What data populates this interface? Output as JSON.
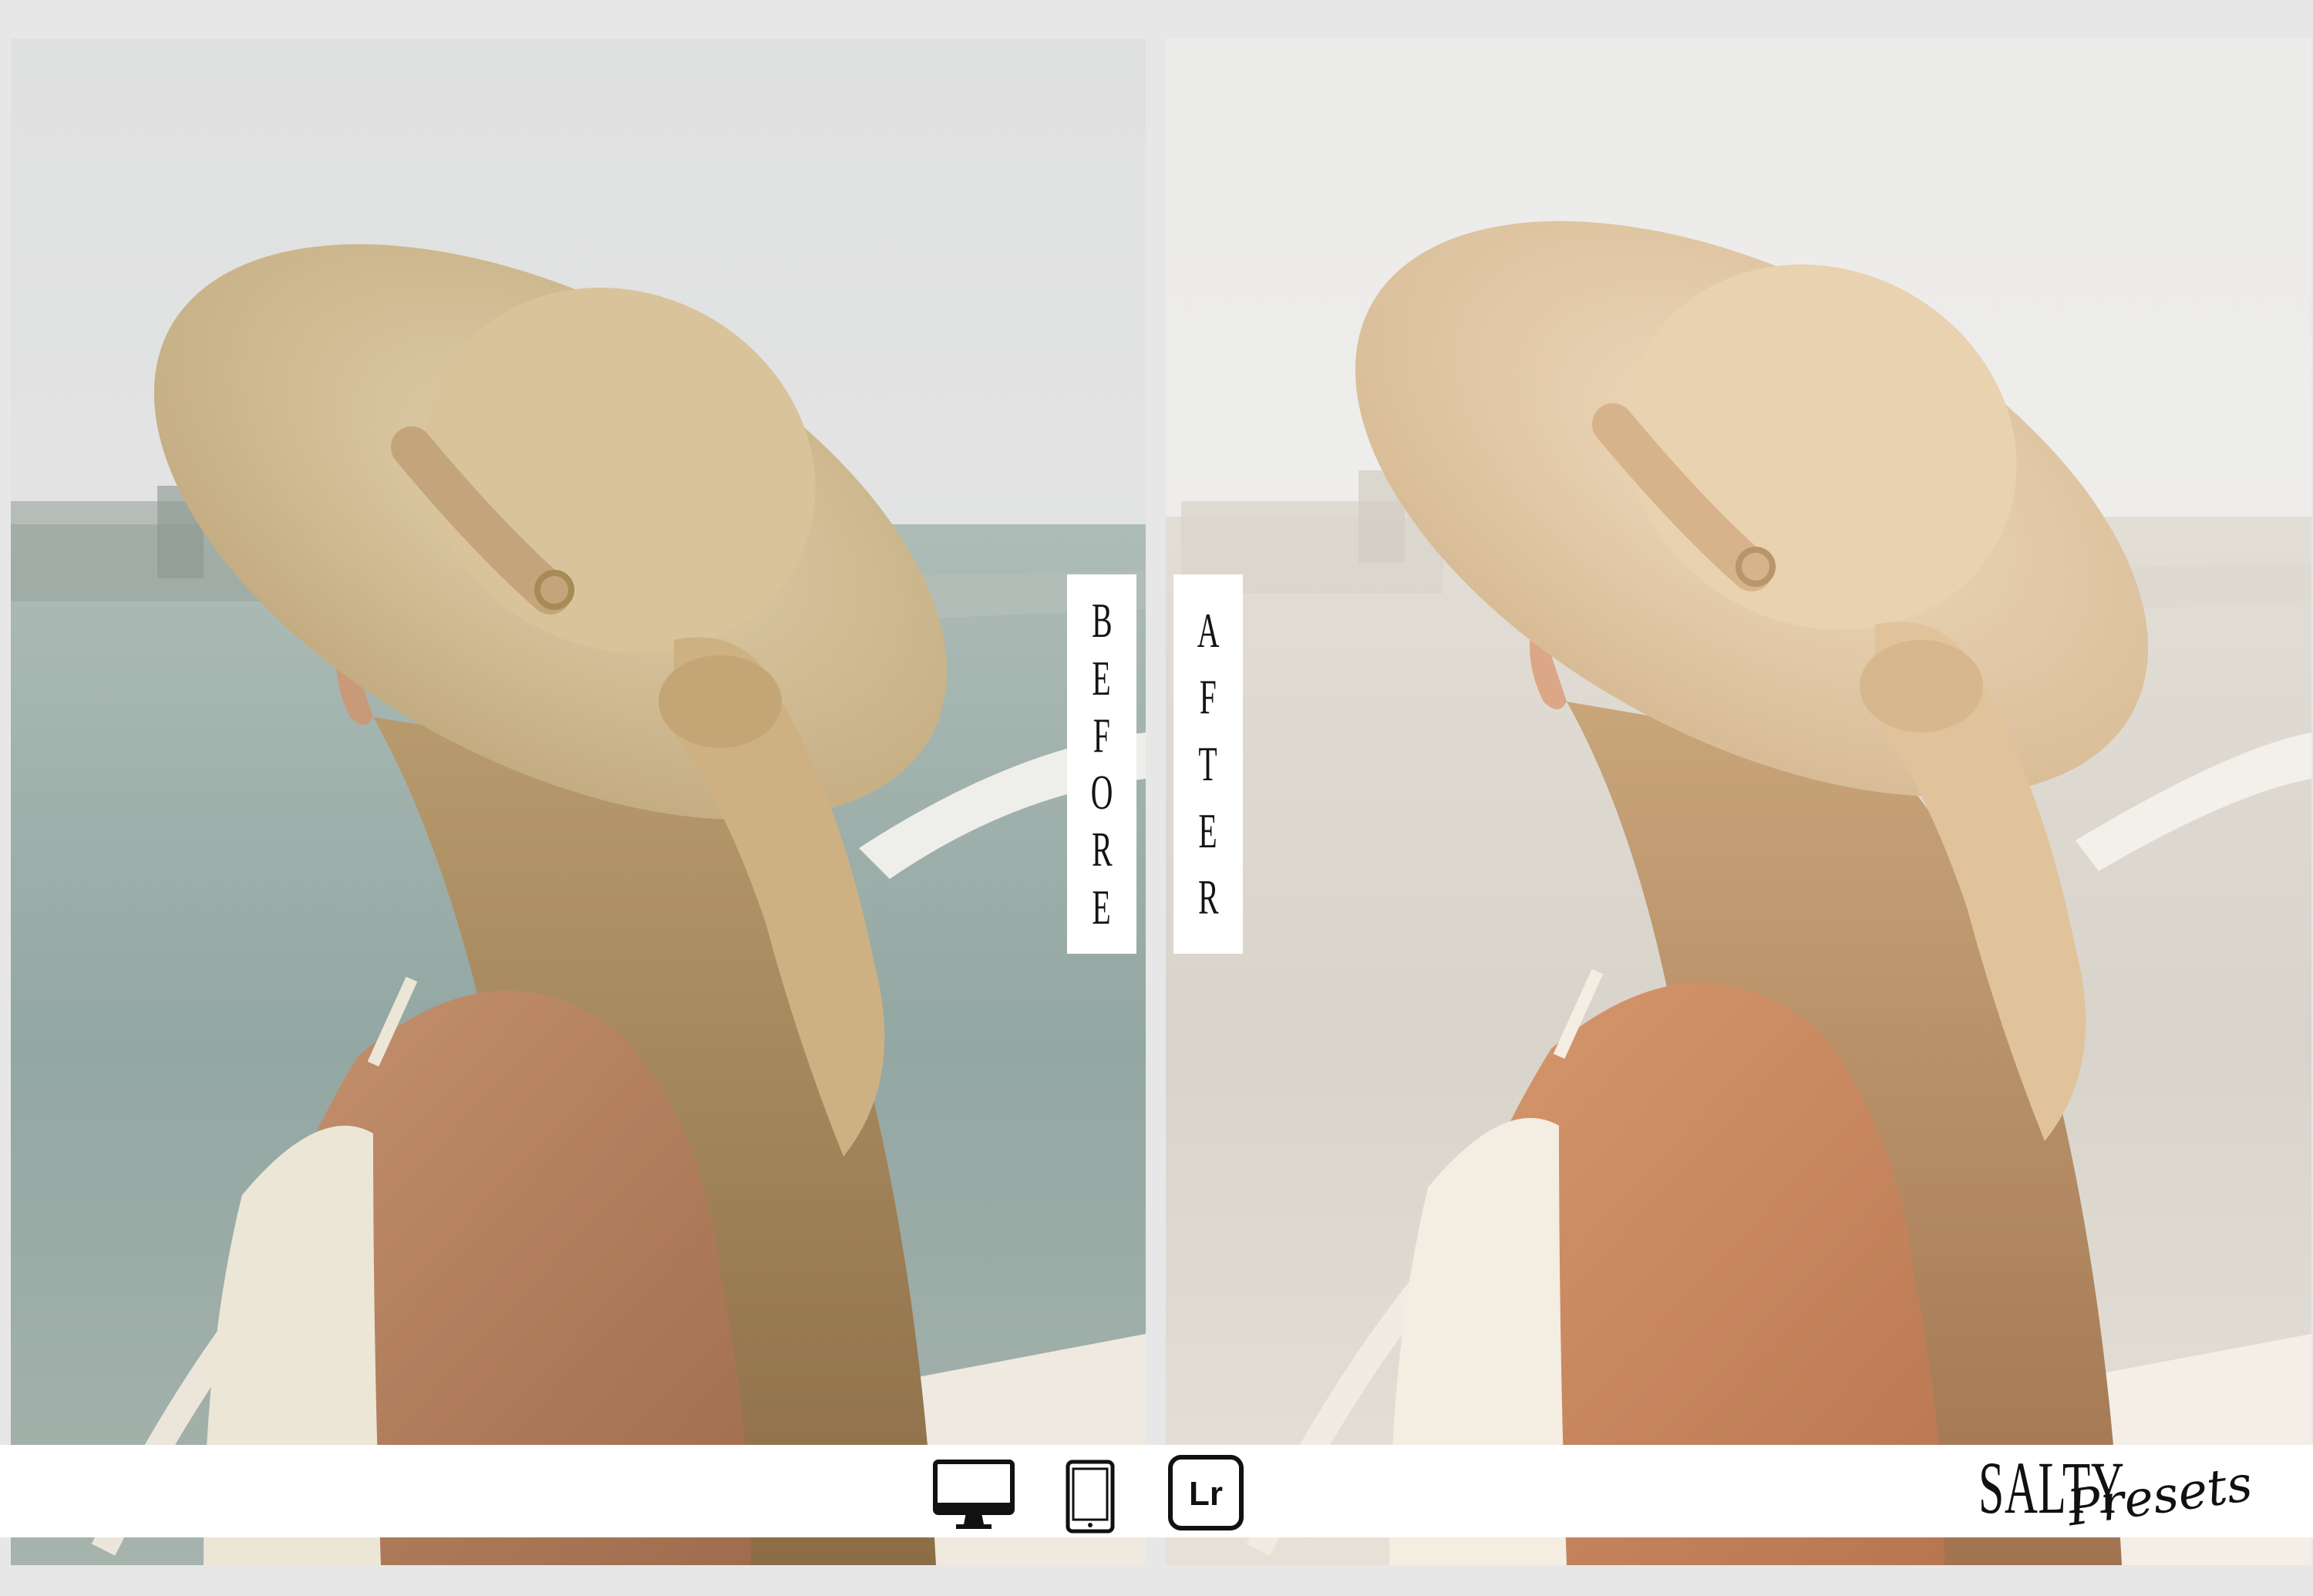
{
  "labels": {
    "before": [
      "B",
      "E",
      "F",
      "O",
      "R",
      "E"
    ],
    "after": [
      "A",
      "F",
      "T",
      "E",
      "R"
    ]
  },
  "footer": {
    "devices": [
      "monitor-icon",
      "tablet-icon",
      "lightroom-icon"
    ],
    "lightroom_text": "Lr",
    "brand_main": "SALTY",
    "brand_script": "Presets"
  },
  "colors": {
    "background": "#e7e7e8",
    "label_bg": "#ffffff",
    "text": "#141414",
    "hat_before": "#d2bb8f",
    "hat_after": "#e2c9a3",
    "water_before": "#9fb2ad",
    "water_after": "#e6e3dc"
  }
}
